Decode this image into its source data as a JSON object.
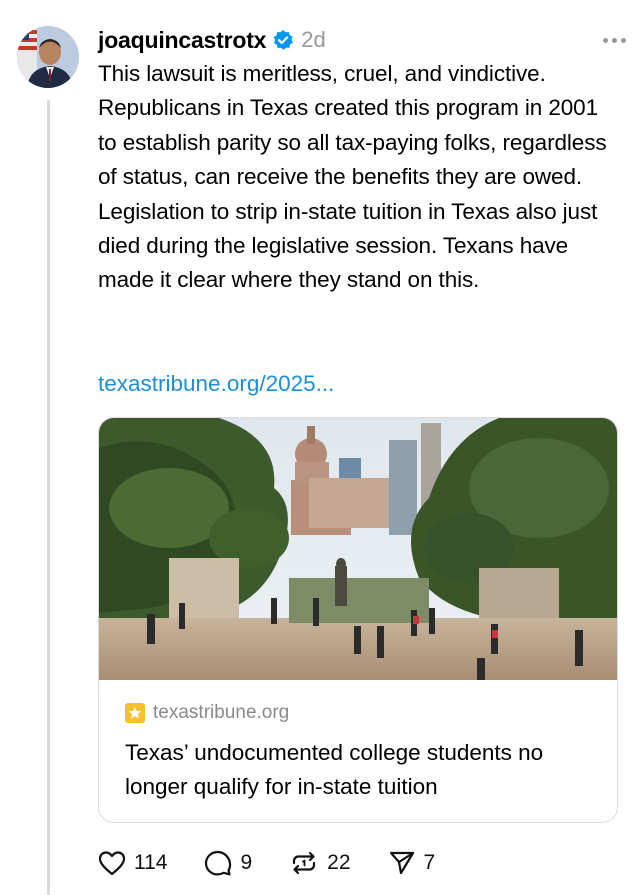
{
  "post": {
    "author": "joaquincastrotx",
    "verified_icon": "verified-badge-icon",
    "time": "2d",
    "more_icon": "more-options-icon",
    "text": "This lawsuit is meritless, cruel, and vindictive. Republicans in Texas created this program in 2001 to establish parity so all tax-paying folks, regardless of status, can receive the benefits they are owed. Legislation to strip in-state tuition in Texas also just died during the legislative session. Texans have made it clear where they stand on this.",
    "link": "texastribune.org/2025..."
  },
  "card": {
    "domain": "texastribune.org",
    "title": "Texas’ undocumented college students no longer qualify for in-state tuition"
  },
  "actions": {
    "likes": "114",
    "replies": "9",
    "reposts": "22",
    "shares": "7"
  },
  "colors": {
    "link": "#1d8fd8",
    "verified": "#0095f6",
    "muted": "#999999",
    "favicon": "#f5c02b"
  }
}
